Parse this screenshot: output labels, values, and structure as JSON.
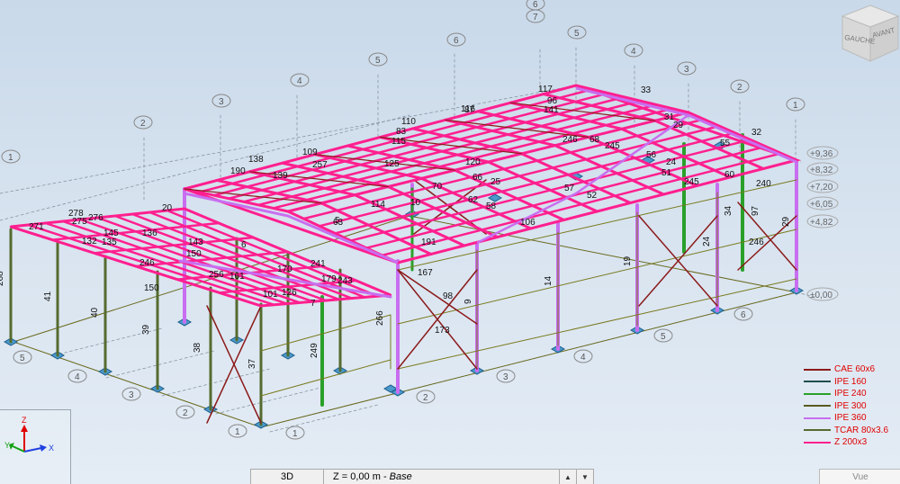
{
  "viewcube": {
    "face_left": "GAUCHE",
    "face_right": "AVANT"
  },
  "legend": [
    {
      "label": "CAE 60x6",
      "color": "#8b1a1a"
    },
    {
      "label": "IPE 160",
      "color": "#1f4e4e"
    },
    {
      "label": "IPE 240",
      "color": "#2aa02a"
    },
    {
      "label": "IPE 300",
      "color": "#5a5a1e"
    },
    {
      "label": "IPE 360",
      "color": "#c86ef0"
    },
    {
      "label": "TCAR 80x3.6",
      "color": "#556b2f"
    },
    {
      "label": "Z 200x3",
      "color": "#ff1f8f"
    }
  ],
  "levels": [
    "+9,36",
    "+8,32",
    "+7,20",
    "+6,05",
    "+4,82",
    "±0,00"
  ],
  "grid_labels": {
    "top": [
      "6",
      "7",
      "6",
      "5",
      "5",
      "4",
      "4",
      "3",
      "3",
      "2",
      "2",
      "1",
      "1"
    ],
    "right_bottom": [
      "6",
      "5",
      "4",
      "3",
      "2",
      "1"
    ],
    "left_bottom": [
      "5",
      "4",
      "3",
      "2",
      "1"
    ],
    "extra": [
      "5",
      "2"
    ]
  },
  "bar_labels": [
    "268",
    "41",
    "40",
    "39",
    "38",
    "37",
    "249",
    "266",
    "9",
    "14",
    "19",
    "24",
    "29",
    "98",
    "167",
    "173",
    "241",
    "243",
    "246",
    "97",
    "34",
    "240",
    "245",
    "246",
    "52",
    "57",
    "62",
    "66",
    "70",
    "58",
    "55",
    "60",
    "51",
    "56",
    "24",
    "29",
    "33",
    "32",
    "31",
    "68",
    "245",
    "246",
    "135",
    "145",
    "150",
    "170",
    "179",
    "190",
    "125",
    "120",
    "115",
    "110",
    "63",
    "106",
    "6",
    "5",
    "10",
    "25",
    "20",
    "275",
    "271",
    "276",
    "278",
    "132",
    "136",
    "143",
    "150",
    "109",
    "116",
    "117",
    "96",
    "83",
    "87",
    "257",
    "114",
    "191",
    "161",
    "256",
    "101",
    "126",
    "139",
    "138",
    "141",
    "7"
  ],
  "axes": {
    "x": "X",
    "y": "Y",
    "z": "Z"
  },
  "statusbar": {
    "view": "3D",
    "level_prefix": "Z = 0,00 m - ",
    "level_name": "Base",
    "up": "▲",
    "down": "▼"
  },
  "tab": {
    "label": "Vue"
  }
}
